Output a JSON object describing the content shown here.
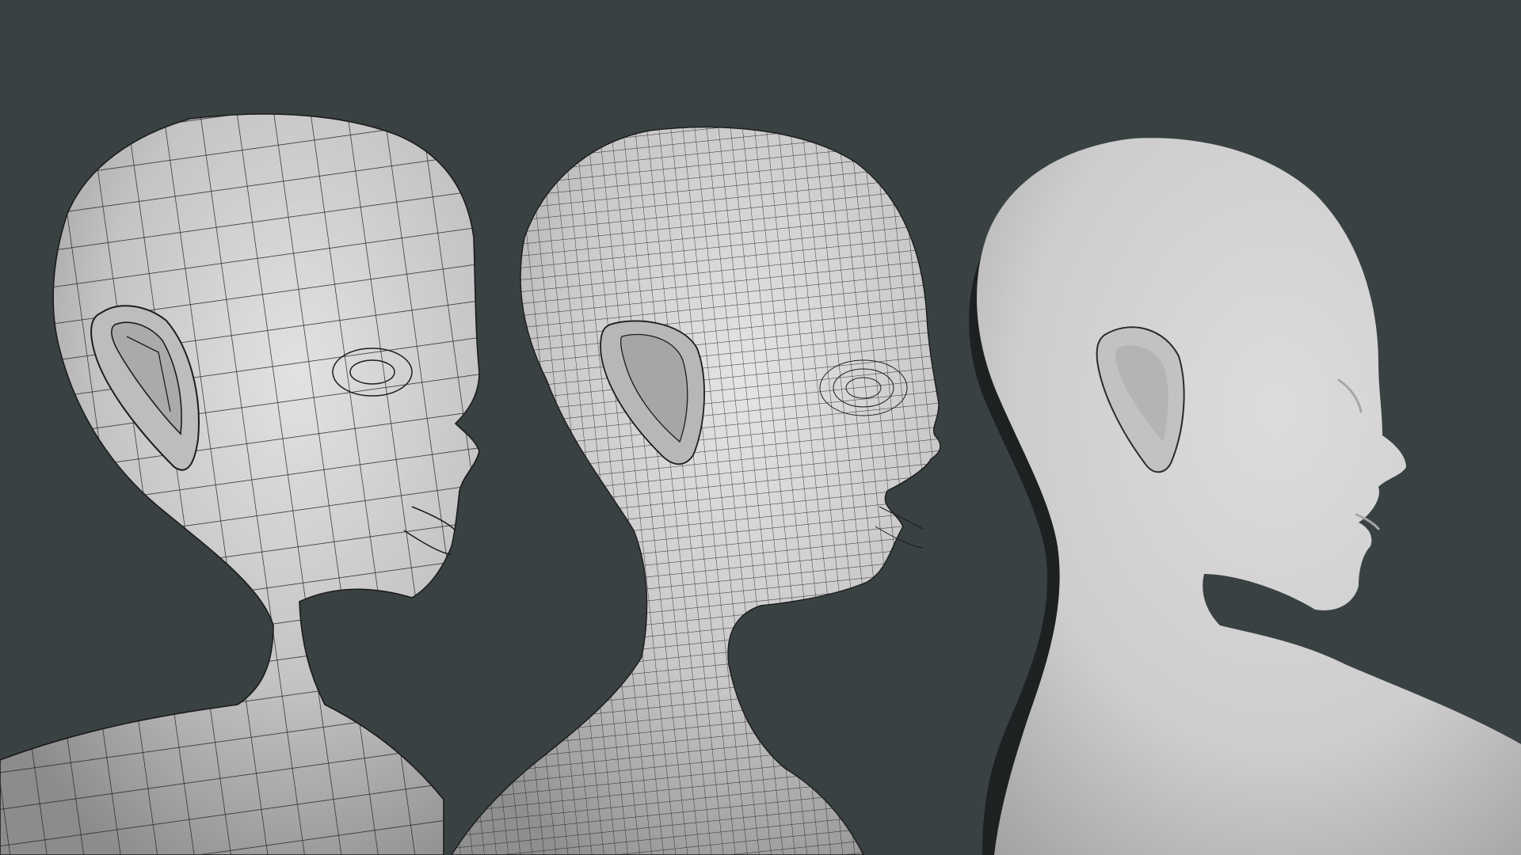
{
  "scene": {
    "background_color": "#3a4142",
    "models": [
      {
        "id": "low-poly-wireframe",
        "display": "wireframe",
        "mesh_density": "low",
        "surface_color": "#c9c9c9",
        "wire_color": "#1c1c1c"
      },
      {
        "id": "subdivided-wireframe",
        "display": "wireframe",
        "mesh_density": "high",
        "surface_color": "#cfcfcf",
        "wire_color": "#1c1c1c"
      },
      {
        "id": "smooth-shaded",
        "display": "smooth",
        "mesh_density": "smooth",
        "surface_color": "#d2d2d2",
        "wire_color": ""
      }
    ]
  }
}
